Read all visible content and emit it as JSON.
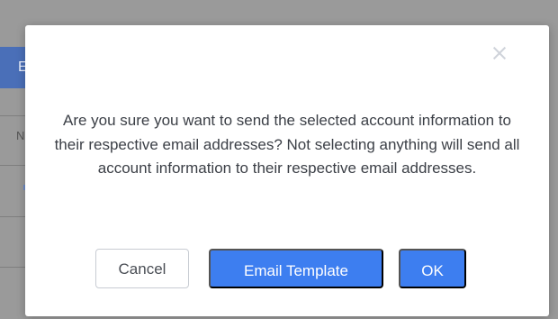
{
  "background": {
    "tab_fragment": "E",
    "column_fragment": "NS"
  },
  "dialog": {
    "close_icon": "close-icon",
    "message": "Are you sure you want to send the selected account information to their respective email addresses? Not selecting anything will send all account information to their respective email addresses.",
    "buttons": {
      "cancel": "Cancel",
      "email_template": "Email Template",
      "ok": "OK"
    }
  },
  "colors": {
    "primary": "#3d7ef0",
    "overlay": "#8a8a8a",
    "text": "#3b3f46"
  }
}
